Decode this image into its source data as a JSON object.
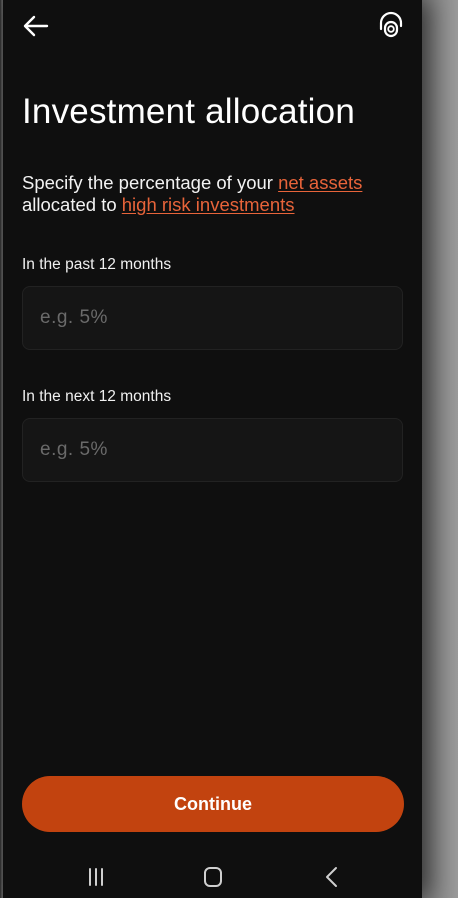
{
  "header": {
    "back_icon": "arrow-left-icon",
    "support_icon": "headset-support-icon"
  },
  "page": {
    "title": "Investment allocation",
    "description_prefix": "Specify the percentage of your ",
    "link_net_assets": "net assets",
    "description_middle": " allocated to ",
    "link_high_risk": "high risk investments"
  },
  "fields": [
    {
      "label": "In the past 12 months",
      "placeholder": "e.g. 5%",
      "value": ""
    },
    {
      "label": "In the next 12 months",
      "placeholder": "e.g. 5%",
      "value": ""
    }
  ],
  "actions": {
    "continue_label": "Continue"
  },
  "system_nav": {
    "recents_icon": "recent-apps-icon",
    "home_icon": "home-icon",
    "back_icon": "system-back-icon"
  },
  "colors": {
    "background": "#0f0f0f",
    "accent": "#c2430f",
    "link": "#e8643a",
    "input_background": "#151515",
    "placeholder": "#6a6a6a"
  }
}
